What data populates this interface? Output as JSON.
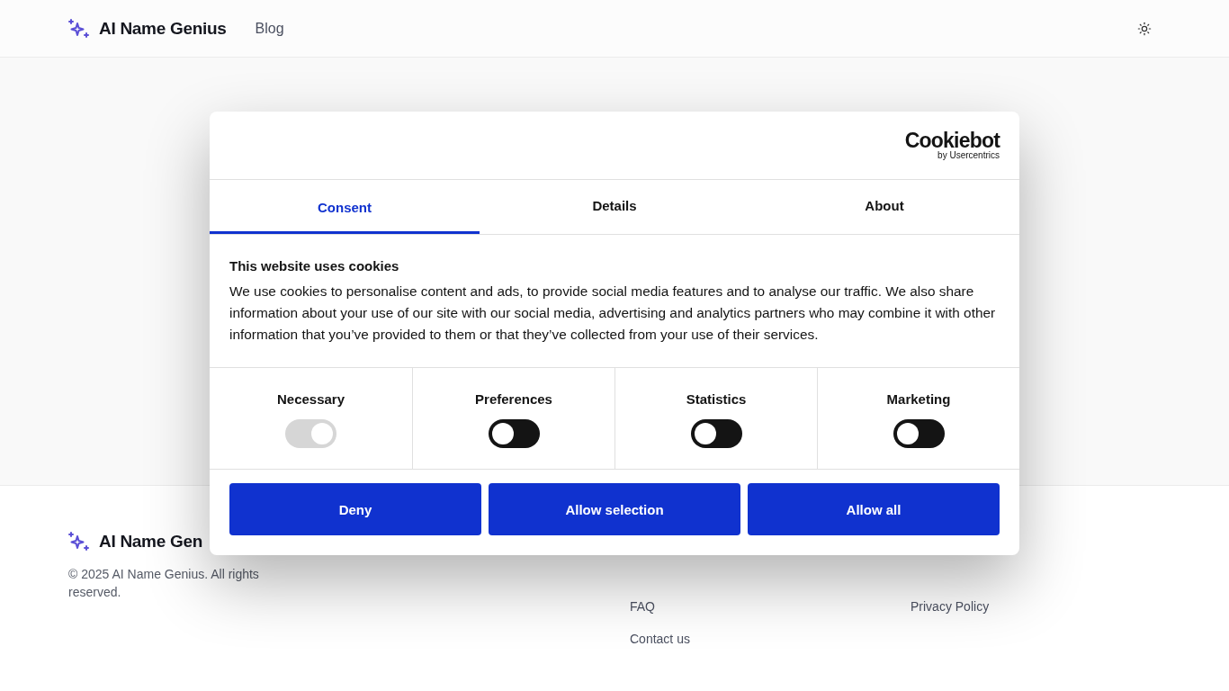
{
  "header": {
    "brand": "AI Name Genius",
    "nav": [
      "Blog"
    ]
  },
  "footer": {
    "brand": "AI Name Gen",
    "copyright": "© 2025 AI Name Genius. All rights reserved.",
    "columns": [
      [],
      [
        "FAQ",
        "Contact us"
      ],
      [
        "Privacy Policy"
      ]
    ]
  },
  "dialog": {
    "logo": {
      "name": "Cookiebot",
      "byline": "by Usercentrics"
    },
    "tabs": [
      {
        "label": "Consent",
        "selected": true
      },
      {
        "label": "Details",
        "selected": false
      },
      {
        "label": "About",
        "selected": false
      }
    ],
    "title": "This website uses cookies",
    "text": "We use cookies to personalise content and ads, to provide social media features and to analyse our traffic. We also share information about your use of our site with our social media, advertising and analytics partners who may combine it with other information that you’ve provided to them or that they’ve collected from your use of their services.",
    "toggles": [
      {
        "label": "Necessary",
        "on": true,
        "disabled": true
      },
      {
        "label": "Preferences",
        "on": false,
        "disabled": false
      },
      {
        "label": "Statistics",
        "on": false,
        "disabled": false
      },
      {
        "label": "Marketing",
        "on": false,
        "disabled": false
      }
    ],
    "buttons": [
      "Deny",
      "Allow selection",
      "Allow all"
    ]
  }
}
